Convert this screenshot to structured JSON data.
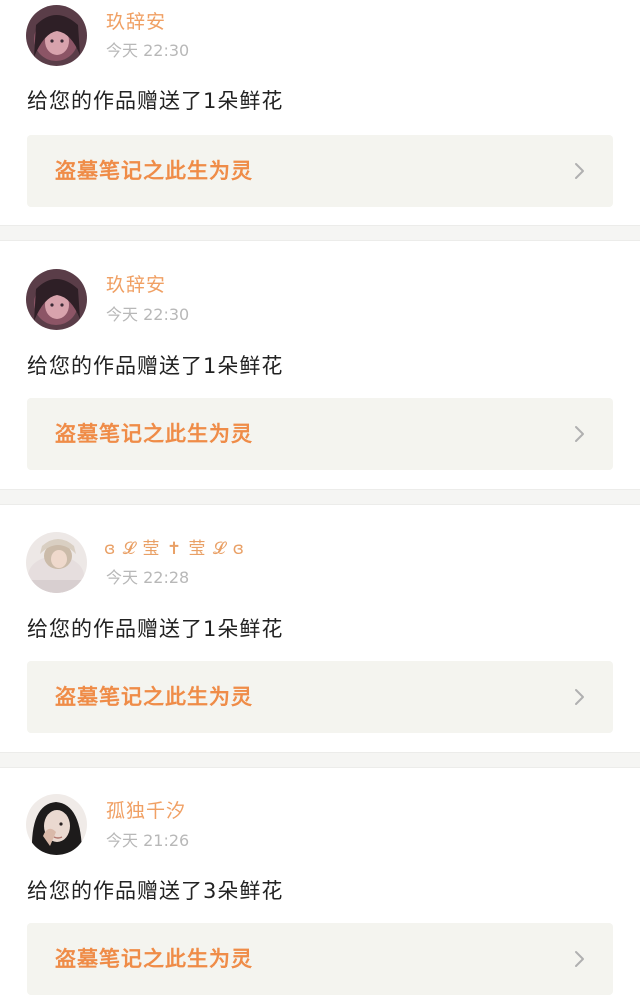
{
  "notifications": [
    {
      "username": "玖辞安",
      "time": "今天 22:30",
      "message": "给您的作品赠送了1朵鲜花",
      "work_title": "盗墓笔记之此生为灵",
      "avatar_icon": "avatar-dark-haired-girl",
      "avatar_colors": [
        "#3a2a35",
        "#8a4a5a",
        "#c98a9a"
      ]
    },
    {
      "username": "玖辞安",
      "time": "今天 22:30",
      "message": "给您的作品赠送了1朵鲜花",
      "work_title": "盗墓笔记之此生为灵",
      "avatar_icon": "avatar-dark-haired-girl",
      "avatar_colors": [
        "#3a2a35",
        "#8a4a5a",
        "#c98a9a"
      ]
    },
    {
      "username": "ɞ 𝓛 莹 ✝ 莹 𝓛 ɞ",
      "time": "今天 22:28",
      "message": "给您的作品赠送了1朵鲜花",
      "work_title": "盗墓笔记之此生为灵",
      "avatar_icon": "avatar-girl-white-hood",
      "avatar_colors": [
        "#e9e4e4",
        "#c8b8a8",
        "#8a7a6a"
      ]
    },
    {
      "username": "孤独千汐",
      "time": "今天 21:26",
      "message": "给您的作品赠送了3朵鲜花",
      "work_title": "盗墓笔记之此生为灵",
      "avatar_icon": "avatar-girl-hand-on-face",
      "avatar_colors": [
        "#1c1c1c",
        "#e8d8d0",
        "#b89a8a"
      ]
    }
  ],
  "accent_color": "#ef8c48",
  "username_color": "#f0a064",
  "chevron_icon": "chevron-right-icon"
}
